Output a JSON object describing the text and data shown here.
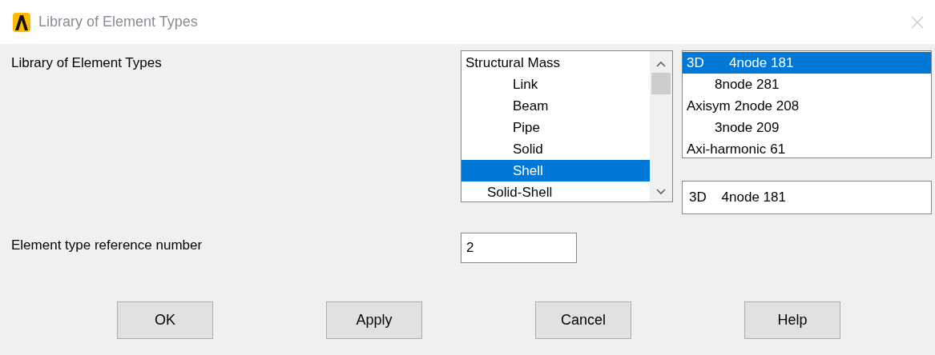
{
  "window": {
    "title": "Library of Element Types"
  },
  "library_label": "Library of Element Types",
  "category_list": {
    "items": [
      {
        "label": "Structural Mass",
        "kind": "title",
        "selected": false
      },
      {
        "label": "Link",
        "kind": "entry",
        "selected": false
      },
      {
        "label": "Beam",
        "kind": "entry",
        "selected": false
      },
      {
        "label": "Pipe",
        "kind": "entry",
        "selected": false
      },
      {
        "label": "Solid",
        "kind": "entry",
        "selected": false
      },
      {
        "label": "Shell",
        "kind": "entry",
        "selected": true
      },
      {
        "label": "Solid-Shell",
        "kind": "group",
        "selected": false
      }
    ]
  },
  "type_list": {
    "items": [
      {
        "prefix": "3D",
        "label": "4node 181",
        "selected": true
      },
      {
        "label": "8node 281",
        "selected": false
      },
      {
        "prefix": "Axisym",
        "label": "2node 208",
        "selected": false
      },
      {
        "label": "3node 209",
        "selected": false
      },
      {
        "prefix": "Axi-harmonic",
        "label": "61",
        "selected": false
      }
    ]
  },
  "selected_type": {
    "value": "3D    4node 181"
  },
  "reference_number": {
    "label": "Element type reference number",
    "value": "2"
  },
  "buttons": [
    "OK",
    "Apply",
    "Cancel",
    "Help"
  ]
}
